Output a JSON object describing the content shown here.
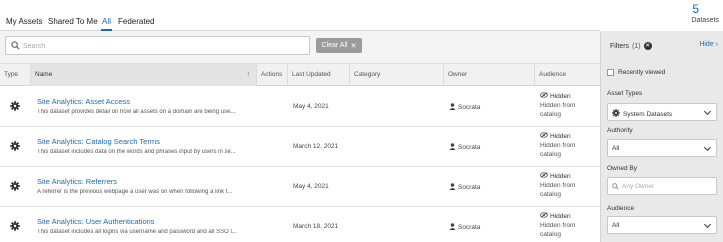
{
  "tabs": [
    "My Assets",
    "Shared To Me",
    "All",
    "Federated"
  ],
  "active_tab": "All",
  "count": {
    "value": "5",
    "label": "Datasets"
  },
  "search": {
    "placeholder": "Search",
    "clear_label": "Clear All"
  },
  "columns": [
    "Type",
    "Name",
    "Actions",
    "Last Updated",
    "Category",
    "Owner",
    "Audience"
  ],
  "rows": [
    {
      "title": "Site Analytics: Asset Access",
      "description": "This dataset provides detail on how all assets on a domain are being use...",
      "updated": "May 4, 2021",
      "owner": "Socrata",
      "audience": "Hidden",
      "audience_sub": "Hidden from catalog"
    },
    {
      "title": "Site Analytics: Catalog Search Terms",
      "description": "This dataset includes data on the words and phrases input by users in se...",
      "updated": "March 12, 2021",
      "owner": "Socrata",
      "audience": "Hidden",
      "audience_sub": "Hidden from catalog"
    },
    {
      "title": "Site Analytics: Referrers",
      "description": "A referrer is the previous webpage a user was on when following a link t...",
      "updated": "May 4, 2021",
      "owner": "Socrata",
      "audience": "Hidden",
      "audience_sub": "Hidden from catalog"
    },
    {
      "title": "Site Analytics: User Authentications",
      "description": "This dataset includes all logins via username and password and all SSO l...",
      "updated": "March 18, 2021",
      "owner": "Socrata",
      "audience": "Hidden",
      "audience_sub": "Hidden from catalog"
    }
  ],
  "filters": {
    "title": "Filters",
    "count": "(1)",
    "hide_label": "Hide",
    "recently_viewed": "Recently viewed",
    "asset_types_label": "Asset Types",
    "asset_types_value": "System Datasets",
    "authority_label": "Authority",
    "authority_value": "All",
    "owned_by_label": "Owned By",
    "owned_by_placeholder": "Any Owner",
    "audience_label": "Audience",
    "audience_value": "All"
  },
  "colors": {
    "link": "#1c6cb0",
    "panel_bg": "#e9e9e9",
    "clear_btn": "#9b9b9b"
  }
}
